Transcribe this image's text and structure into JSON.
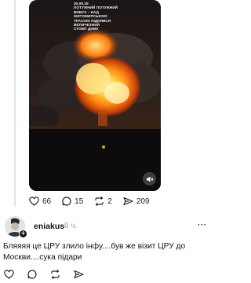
{
  "post": {
    "video_overlay_lines": [
      "30.09.25",
      "ПОТУЖНИЙ ПОТУЖНИЙ",
      "ВИБУХ – НАД",
      "ЖИТОМИРСЬКОЮ",
      "ТРАСОЮ ПІДНЯВСЯ",
      "ВЕЛИЧЕЗНИЙ",
      "СТОВП ДИМУ"
    ],
    "actions": {
      "likes": "66",
      "comments": "15",
      "reposts": "2",
      "shares": "209"
    }
  },
  "reply": {
    "username": "eniakus",
    "time": "6 ч.",
    "more_label": "···",
    "text": "Бляяяя це ЦРУ злило інфу....був же візит ЦРУ до Москви....сука підари",
    "actions": {
      "likes": "",
      "comments": "",
      "reposts": "",
      "shares": ""
    }
  },
  "icons": {
    "like": "heart-icon",
    "comment": "comment-icon",
    "repost": "repost-icon",
    "share": "share-icon",
    "mute": "volume-mute-icon"
  }
}
